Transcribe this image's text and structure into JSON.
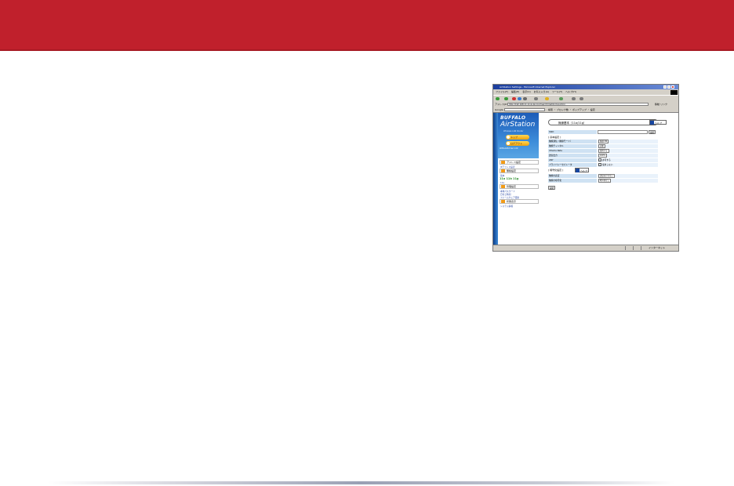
{
  "colors": {
    "banner": "#c0202c",
    "sidebar_blue": "#2a6fc7",
    "accent_orange": "#f29b18"
  },
  "screenshot": {
    "window_title": "AirStation Settings - Microsoft Internet Explorer",
    "menu": [
      "ファイル(F)",
      "編集(E)",
      "表示(V)",
      "お気に入り(A)",
      "ツール(T)",
      "ヘルプ(H)"
    ],
    "address_label": "アドレス(D)",
    "address_value": "http://192.168.11.1/cgi-bin/cgi?req=frm&frm=top.html",
    "go_label": "移動 リンク",
    "google_label": "Google",
    "google_rest": "検索 ・ ブロック数 ・ ポップアップ ・ 設定",
    "brand": "BUFFALO",
    "product": "AirStation",
    "product_sub": "Wireless LAN Router",
    "top_button": "トップ",
    "logout_button": "ログアウト",
    "firmware": "WZR-AG54 Ver.1.00",
    "nav": [
      {
        "head": "アドレス設定",
        "subs": [
          "IPアドレス設定"
        ]
      },
      {
        "head": "無線設定",
        "subs": [
          "基本",
          "11a",
          "11b/g"
        ]
      },
      {
        "head": "管理設定",
        "subs": [
          "本体パスワード",
          "日付と時刻",
          "ファームウェア更新"
        ]
      },
      {
        "head": "状態表示",
        "subs": [
          "システム情報"
        ]
      }
    ],
    "signal": "11a 11b 11g",
    "tab_title": "無線基本（11a/11g）",
    "help": "ヘルプ",
    "ssid_label": "SSID",
    "set_button": "設定",
    "section1": "[ 基本設定 ]",
    "rows": [
      {
        "k": "無線通信（無線モード）",
        "v": "無線 ON"
      },
      {
        "k": "無線チャンネル",
        "v": "自動"
      },
      {
        "k": "Xtreme Rate",
        "v": "使用する"
      },
      {
        "k": "送信出力",
        "v": "100%"
      },
      {
        "k": "ANY",
        "v": "許可する"
      },
      {
        "k": "プライバシーセパレータ",
        "v": "使用しない"
      }
    ],
    "section2": "[ 暗号化設定 ]",
    "rows2": [
      {
        "k": "無線の認証",
        "v": "認証を行わない"
      },
      {
        "k": "無線の暗号化",
        "v": "暗号化なし"
      }
    ],
    "apply_button": "設定",
    "status_zone": "インターネット"
  }
}
